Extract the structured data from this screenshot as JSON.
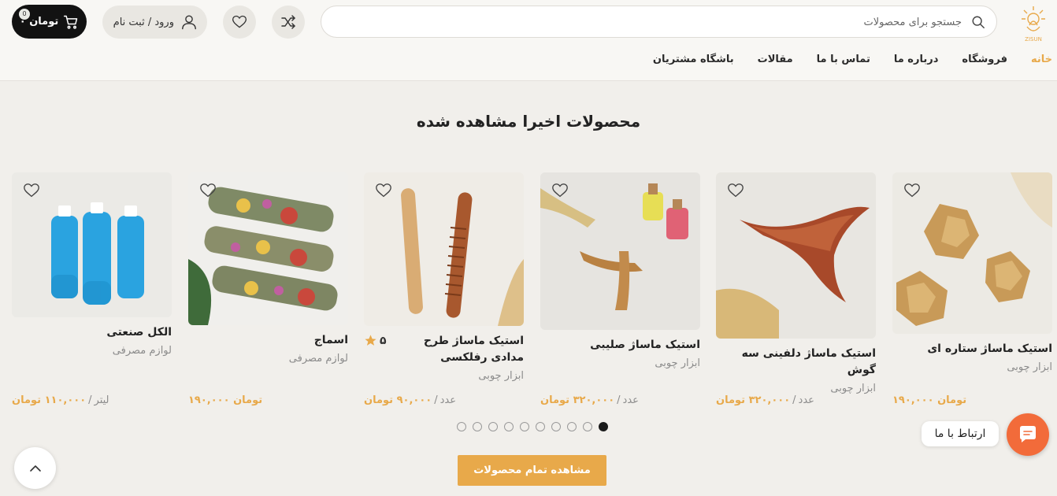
{
  "header": {
    "logo_text": "ZISUN",
    "search_placeholder": "جستجو برای محصولات",
    "login_label": "ورود / ثبت نام",
    "cart_label": "۰ تومان",
    "cart_count": "0",
    "nav": [
      "خانه",
      "فروشگاه",
      "درباره ما",
      "تماس با ما",
      "مقالات",
      "باشگاه مشتریان"
    ]
  },
  "section": {
    "title": "محصولات اخیرا مشاهده شده",
    "view_all_label": "مشاهده تمام محصولات"
  },
  "products": [
    {
      "name": "استیک ماساژ ستاره ای",
      "category": "ابزار چوبی",
      "price": "۱۹۰,۰۰۰ تومان",
      "unit": ""
    },
    {
      "name": "استیک ماساژ دلفینی سه گوش",
      "category": "ابزار چوبی",
      "price": "۳۲۰,۰۰۰ تومان",
      "unit": "عدد"
    },
    {
      "name": "استیک ماساژ صلیبی",
      "category": "ابزار چوبی",
      "price": "۳۲۰,۰۰۰ تومان",
      "unit": "عدد"
    },
    {
      "name": "استیک ماساژ طرح مدادی رفلکسی",
      "category": "ابزار چوبی",
      "price": "۹۰,۰۰۰ تومان",
      "unit": "عدد",
      "rating": "۵"
    },
    {
      "name": "اسماج",
      "category": "لوازم مصرفی",
      "price": "۱۹۰,۰۰۰ تومان",
      "unit": ""
    },
    {
      "name": "الکل صنعتی",
      "category": "لوازم مصرفی",
      "price": "۱۱۰,۰۰۰ تومان",
      "unit": "لیتر"
    }
  ],
  "carousel": {
    "total_pages": 10,
    "active_page": 1
  },
  "chat": {
    "label": "ارتباط با ما"
  },
  "colors": {
    "accent": "#e8a94a",
    "dark": "#121212",
    "chat": "#f26b3a",
    "background": "#f1efeb"
  }
}
